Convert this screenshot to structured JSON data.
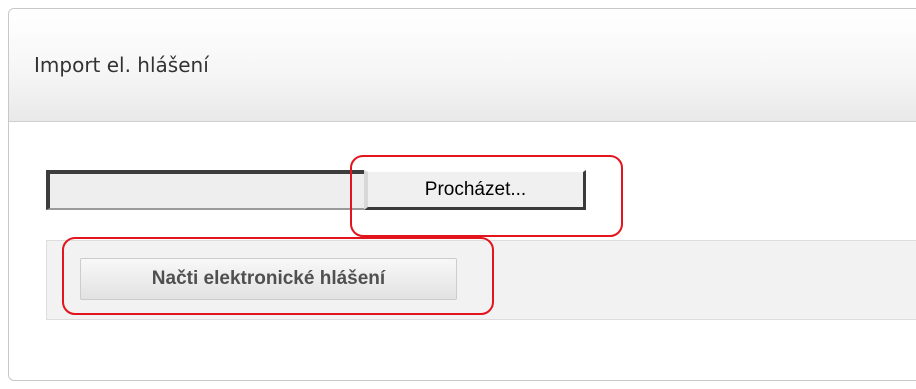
{
  "dialog": {
    "title": "Import el. hlášení"
  },
  "file_input": {
    "value": "",
    "browse_label": "Procházet..."
  },
  "actions": {
    "load_label": "Načti elektronické hlášení"
  },
  "annotations": {
    "highlight_color": "#e2141e"
  }
}
